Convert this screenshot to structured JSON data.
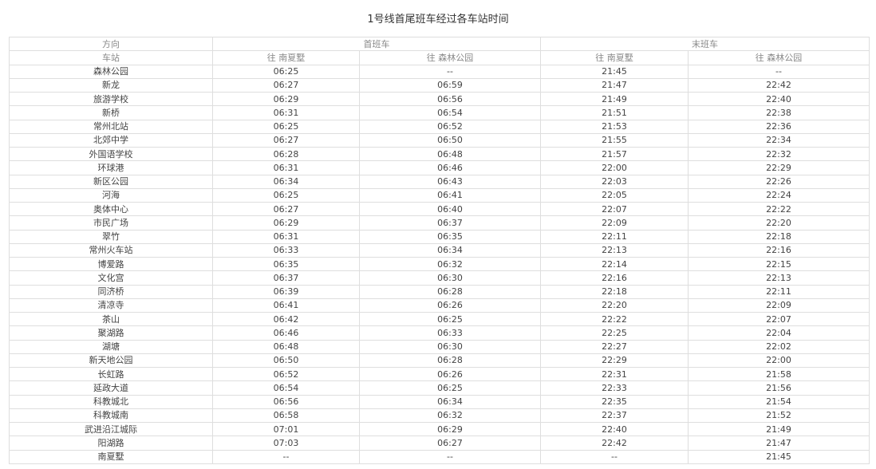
{
  "title": "1号线首尾班车经过各车站时间",
  "header": {
    "direction_label": "方向",
    "first_train_label": "首班车",
    "last_train_label": "末班车",
    "station_label": "车站",
    "to_nanxiashu": "往 南夏墅",
    "to_senlin_park": "往 森林公园"
  },
  "rows": [
    {
      "station": "森林公园",
      "first_to_nanxiashu": "06:25",
      "first_to_senlin": "--",
      "last_to_nanxiashu": "21:45",
      "last_to_senlin": "--"
    },
    {
      "station": "新龙",
      "first_to_nanxiashu": "06:27",
      "first_to_senlin": "06:59",
      "last_to_nanxiashu": "21:47",
      "last_to_senlin": "22:42"
    },
    {
      "station": "旅游学校",
      "first_to_nanxiashu": "06:29",
      "first_to_senlin": "06:56",
      "last_to_nanxiashu": "21:49",
      "last_to_senlin": "22:40"
    },
    {
      "station": "新桥",
      "first_to_nanxiashu": "06:31",
      "first_to_senlin": "06:54",
      "last_to_nanxiashu": "21:51",
      "last_to_senlin": "22:38"
    },
    {
      "station": "常州北站",
      "first_to_nanxiashu": "06:25",
      "first_to_senlin": "06:52",
      "last_to_nanxiashu": "21:53",
      "last_to_senlin": "22:36"
    },
    {
      "station": "北郊中学",
      "first_to_nanxiashu": "06:27",
      "first_to_senlin": "06:50",
      "last_to_nanxiashu": "21:55",
      "last_to_senlin": "22:34"
    },
    {
      "station": "外国语学校",
      "first_to_nanxiashu": "06:28",
      "first_to_senlin": "06:48",
      "last_to_nanxiashu": "21:57",
      "last_to_senlin": "22:32"
    },
    {
      "station": "环球港",
      "first_to_nanxiashu": "06:31",
      "first_to_senlin": "06:46",
      "last_to_nanxiashu": "22:00",
      "last_to_senlin": "22:29"
    },
    {
      "station": "新区公园",
      "first_to_nanxiashu": "06:34",
      "first_to_senlin": "06:43",
      "last_to_nanxiashu": "22:03",
      "last_to_senlin": "22:26"
    },
    {
      "station": "河海",
      "first_to_nanxiashu": "06:25",
      "first_to_senlin": "06:41",
      "last_to_nanxiashu": "22:05",
      "last_to_senlin": "22:24"
    },
    {
      "station": "奥体中心",
      "first_to_nanxiashu": "06:27",
      "first_to_senlin": "06:40",
      "last_to_nanxiashu": "22:07",
      "last_to_senlin": "22:22"
    },
    {
      "station": "市民广场",
      "first_to_nanxiashu": "06:29",
      "first_to_senlin": "06:37",
      "last_to_nanxiashu": "22:09",
      "last_to_senlin": "22:20"
    },
    {
      "station": "翠竹",
      "first_to_nanxiashu": "06:31",
      "first_to_senlin": "06:35",
      "last_to_nanxiashu": "22:11",
      "last_to_senlin": "22:18"
    },
    {
      "station": "常州火车站",
      "first_to_nanxiashu": "06:33",
      "first_to_senlin": "06:34",
      "last_to_nanxiashu": "22:13",
      "last_to_senlin": "22:16"
    },
    {
      "station": "博爱路",
      "first_to_nanxiashu": "06:35",
      "first_to_senlin": "06:32",
      "last_to_nanxiashu": "22:14",
      "last_to_senlin": "22:15"
    },
    {
      "station": "文化宫",
      "first_to_nanxiashu": "06:37",
      "first_to_senlin": "06:30",
      "last_to_nanxiashu": "22:16",
      "last_to_senlin": "22:13"
    },
    {
      "station": "同济桥",
      "first_to_nanxiashu": "06:39",
      "first_to_senlin": "06:28",
      "last_to_nanxiashu": "22:18",
      "last_to_senlin": "22:11"
    },
    {
      "station": "清凉寺",
      "first_to_nanxiashu": "06:41",
      "first_to_senlin": "06:26",
      "last_to_nanxiashu": "22:20",
      "last_to_senlin": "22:09"
    },
    {
      "station": "茶山",
      "first_to_nanxiashu": "06:42",
      "first_to_senlin": "06:25",
      "last_to_nanxiashu": "22:22",
      "last_to_senlin": "22:07"
    },
    {
      "station": "聚湖路",
      "first_to_nanxiashu": "06:46",
      "first_to_senlin": "06:33",
      "last_to_nanxiashu": "22:25",
      "last_to_senlin": "22:04"
    },
    {
      "station": "湖塘",
      "first_to_nanxiashu": "06:48",
      "first_to_senlin": "06:30",
      "last_to_nanxiashu": "22:27",
      "last_to_senlin": "22:02"
    },
    {
      "station": "新天地公园",
      "first_to_nanxiashu": "06:50",
      "first_to_senlin": "06:28",
      "last_to_nanxiashu": "22:29",
      "last_to_senlin": "22:00"
    },
    {
      "station": "长虹路",
      "first_to_nanxiashu": "06:52",
      "first_to_senlin": "06:26",
      "last_to_nanxiashu": "22:31",
      "last_to_senlin": "21:58"
    },
    {
      "station": "延政大道",
      "first_to_nanxiashu": "06:54",
      "first_to_senlin": "06:25",
      "last_to_nanxiashu": "22:33",
      "last_to_senlin": "21:56"
    },
    {
      "station": "科教城北",
      "first_to_nanxiashu": "06:56",
      "first_to_senlin": "06:34",
      "last_to_nanxiashu": "22:35",
      "last_to_senlin": "21:54"
    },
    {
      "station": "科教城南",
      "first_to_nanxiashu": "06:58",
      "first_to_senlin": "06:32",
      "last_to_nanxiashu": "22:37",
      "last_to_senlin": "21:52"
    },
    {
      "station": "武进沿江城际",
      "first_to_nanxiashu": "07:01",
      "first_to_senlin": "06:29",
      "last_to_nanxiashu": "22:40",
      "last_to_senlin": "21:49"
    },
    {
      "station": "阳湖路",
      "first_to_nanxiashu": "07:03",
      "first_to_senlin": "06:27",
      "last_to_nanxiashu": "22:42",
      "last_to_senlin": "21:47"
    },
    {
      "station": "南夏墅",
      "first_to_nanxiashu": "--",
      "first_to_senlin": "--",
      "last_to_nanxiashu": "--",
      "last_to_senlin": "21:45"
    }
  ]
}
